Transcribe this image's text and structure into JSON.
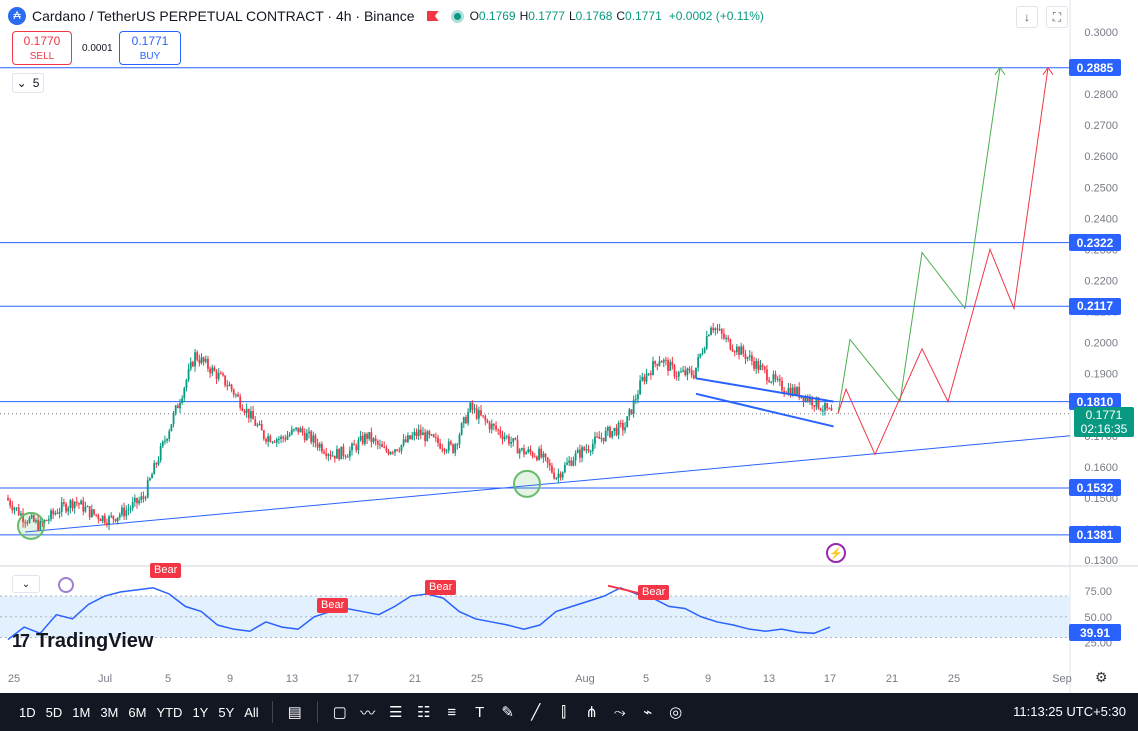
{
  "header": {
    "title": "Cardano / TetherUS PERPETUAL CONTRACT · 4h · Binance",
    "ohlc": {
      "o": "0.1769",
      "h": "0.1777",
      "l": "0.1768",
      "c": "0.1771",
      "change": "+0.0002 (+0.11%)"
    }
  },
  "trade": {
    "sell_price": "0.1770",
    "sell_label": "SELL",
    "spread": "0.0001",
    "buy_price": "0.1771",
    "buy_label": "BUY"
  },
  "indicator_count": "5",
  "current_price": {
    "price": "0.1771",
    "countdown": "02:16:35"
  },
  "rsi_value": "39.91",
  "bear_labels": [
    "Bear",
    "Bear",
    "Bear",
    "Bear"
  ],
  "logo_text": "TradingView",
  "toolbar": {
    "timeframes": [
      "1D",
      "5D",
      "1M",
      "3M",
      "6M",
      "YTD",
      "1Y",
      "5Y",
      "All"
    ],
    "clock": "11:13:25 UTC+5:30"
  },
  "icons": [
    "coin-icon",
    "flag-icon",
    "market-status-icon",
    "arrow-down-icon",
    "fullscreen-icon",
    "chevron-down-icon",
    "lightning-icon",
    "gear-icon",
    "logo-icon"
  ],
  "colors": {
    "up": "#089981",
    "down": "#f23645",
    "line": "#2962ff",
    "rsi": "#2962ff",
    "rsi_band": "#e3f0fd",
    "path_green": "#4caf50",
    "path_red": "#f23645"
  },
  "chart_data": {
    "type": "candlestick",
    "price_axis": {
      "min": 0.13,
      "max": 0.3,
      "ticks": [
        "0.3000",
        "0.2900",
        "0.2800",
        "0.2700",
        "0.2600",
        "0.2500",
        "0.2400",
        "0.2300",
        "0.2200",
        "0.2100",
        "0.2000",
        "0.1900",
        "0.1800",
        "0.1700",
        "0.1600",
        "0.1500",
        "0.1400",
        "0.1300"
      ]
    },
    "time_axis": {
      "labels": [
        "25",
        "Jul",
        "5",
        "9",
        "13",
        "17",
        "21",
        "25",
        "Aug",
        "5",
        "9",
        "13",
        "17",
        "21",
        "25",
        "Sep"
      ]
    },
    "horizontal_levels": [
      0.2885,
      0.2322,
      0.2117,
      0.181,
      0.1532,
      0.1381
    ],
    "level_labels": [
      "0.2885",
      "0.2322",
      "0.2117",
      "0.1810",
      "0.1532",
      "0.1381"
    ],
    "close_path": [
      [
        0,
        0.15
      ],
      [
        1,
        0.144
      ],
      [
        2,
        0.141
      ],
      [
        3,
        0.146
      ],
      [
        4,
        0.149
      ],
      [
        5,
        0.145
      ],
      [
        6,
        0.143
      ],
      [
        7,
        0.146
      ],
      [
        8,
        0.15
      ],
      [
        9,
        0.165
      ],
      [
        10,
        0.18
      ],
      [
        11,
        0.196
      ],
      [
        12,
        0.191
      ],
      [
        13,
        0.186
      ],
      [
        14,
        0.178
      ],
      [
        15,
        0.17
      ],
      [
        16,
        0.169
      ],
      [
        17,
        0.172
      ],
      [
        18,
        0.168
      ],
      [
        19,
        0.164
      ],
      [
        20,
        0.165
      ],
      [
        21,
        0.17
      ],
      [
        22,
        0.165
      ],
      [
        23,
        0.167
      ],
      [
        24,
        0.171
      ],
      [
        25,
        0.168
      ],
      [
        26,
        0.166
      ],
      [
        27,
        0.179
      ],
      [
        28,
        0.174
      ],
      [
        29,
        0.17
      ],
      [
        30,
        0.165
      ],
      [
        31,
        0.164
      ],
      [
        32,
        0.157
      ],
      [
        33,
        0.163
      ],
      [
        34,
        0.167
      ],
      [
        35,
        0.171
      ],
      [
        36,
        0.173
      ],
      [
        37,
        0.188
      ],
      [
        38,
        0.195
      ],
      [
        39,
        0.19
      ],
      [
        40,
        0.19
      ],
      [
        41,
        0.206
      ],
      [
        42,
        0.2
      ],
      [
        43,
        0.196
      ],
      [
        44,
        0.191
      ],
      [
        45,
        0.186
      ],
      [
        46,
        0.184
      ],
      [
        47,
        0.181
      ],
      [
        48,
        0.1771
      ]
    ],
    "channel": {
      "upper": [
        [
          0.1885,
          40
        ],
        [
          0.181,
          48
        ]
      ],
      "lower": [
        [
          0.1835,
          40
        ],
        [
          0.173,
          48
        ]
      ]
    },
    "trendline": [
      [
        0.139,
        1
      ],
      [
        0.17,
        60
      ]
    ],
    "support_circles": [
      0.141,
      0.1545
    ],
    "projection_green": [
      0.1771,
      0.201,
      0.181,
      0.229,
      0.211,
      0.2885
    ],
    "projection_red": [
      0.1771,
      0.185,
      0.164,
      0.198,
      0.181,
      0.23,
      0.211,
      0.2885
    ],
    "rsi": {
      "ticks": [
        "75.00",
        "50.00",
        "25.00"
      ],
      "levels": [
        70,
        30
      ],
      "values": [
        28,
        40,
        34,
        52,
        48,
        62,
        70,
        74,
        76,
        78,
        72,
        60,
        55,
        42,
        38,
        36,
        45,
        40,
        38,
        50,
        55,
        58,
        55,
        52,
        60,
        70,
        72,
        68,
        55,
        48,
        45,
        42,
        38,
        42,
        55,
        60,
        65,
        70,
        78,
        72,
        68,
        60,
        58,
        50,
        45,
        42,
        38,
        36,
        38,
        35,
        34,
        40
      ]
    }
  }
}
